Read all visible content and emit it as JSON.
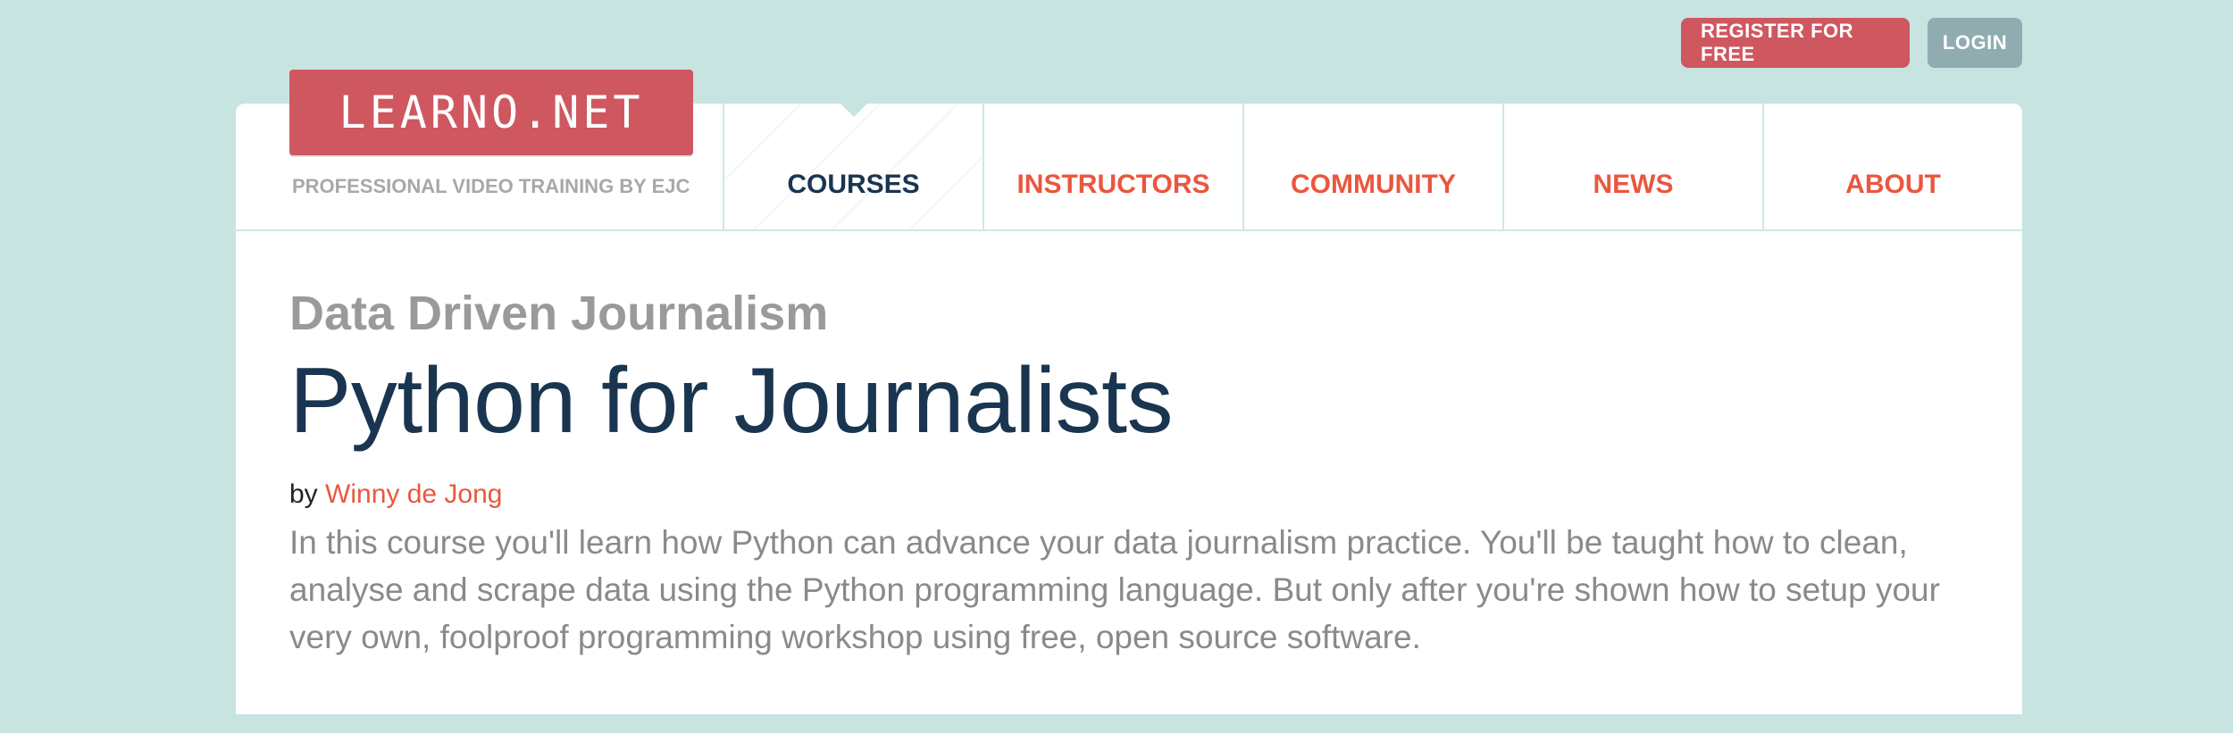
{
  "top_actions": {
    "register_label": "REGISTER FOR FREE",
    "login_label": "LOGIN"
  },
  "brand": {
    "logo_text": "LEARNO.NET",
    "tagline": "PROFESSIONAL VIDEO TRAINING BY EJC"
  },
  "nav": {
    "items": [
      {
        "label": "COURSES",
        "active": true
      },
      {
        "label": "INSTRUCTORS",
        "active": false
      },
      {
        "label": "COMMUNITY",
        "active": false
      },
      {
        "label": "NEWS",
        "active": false
      },
      {
        "label": "ABOUT",
        "active": false
      }
    ]
  },
  "course": {
    "category": "Data Driven Journalism",
    "title": "Python for Journalists",
    "by_prefix": "by",
    "instructor": "Winny de Jong",
    "description": "In this course you'll learn how Python can advance your data journalism practice. You'll be taught how to clean, analyse and scrape data using the Python programming language. But only after you're shown how to setup your very own, foolproof programming workshop using free, open source software."
  },
  "colors": {
    "background": "#c8e4e1",
    "brand_red": "#cf5760",
    "nav_link": "#e9573f",
    "nav_active": "#1a3550",
    "login_button": "#8fadb1"
  }
}
